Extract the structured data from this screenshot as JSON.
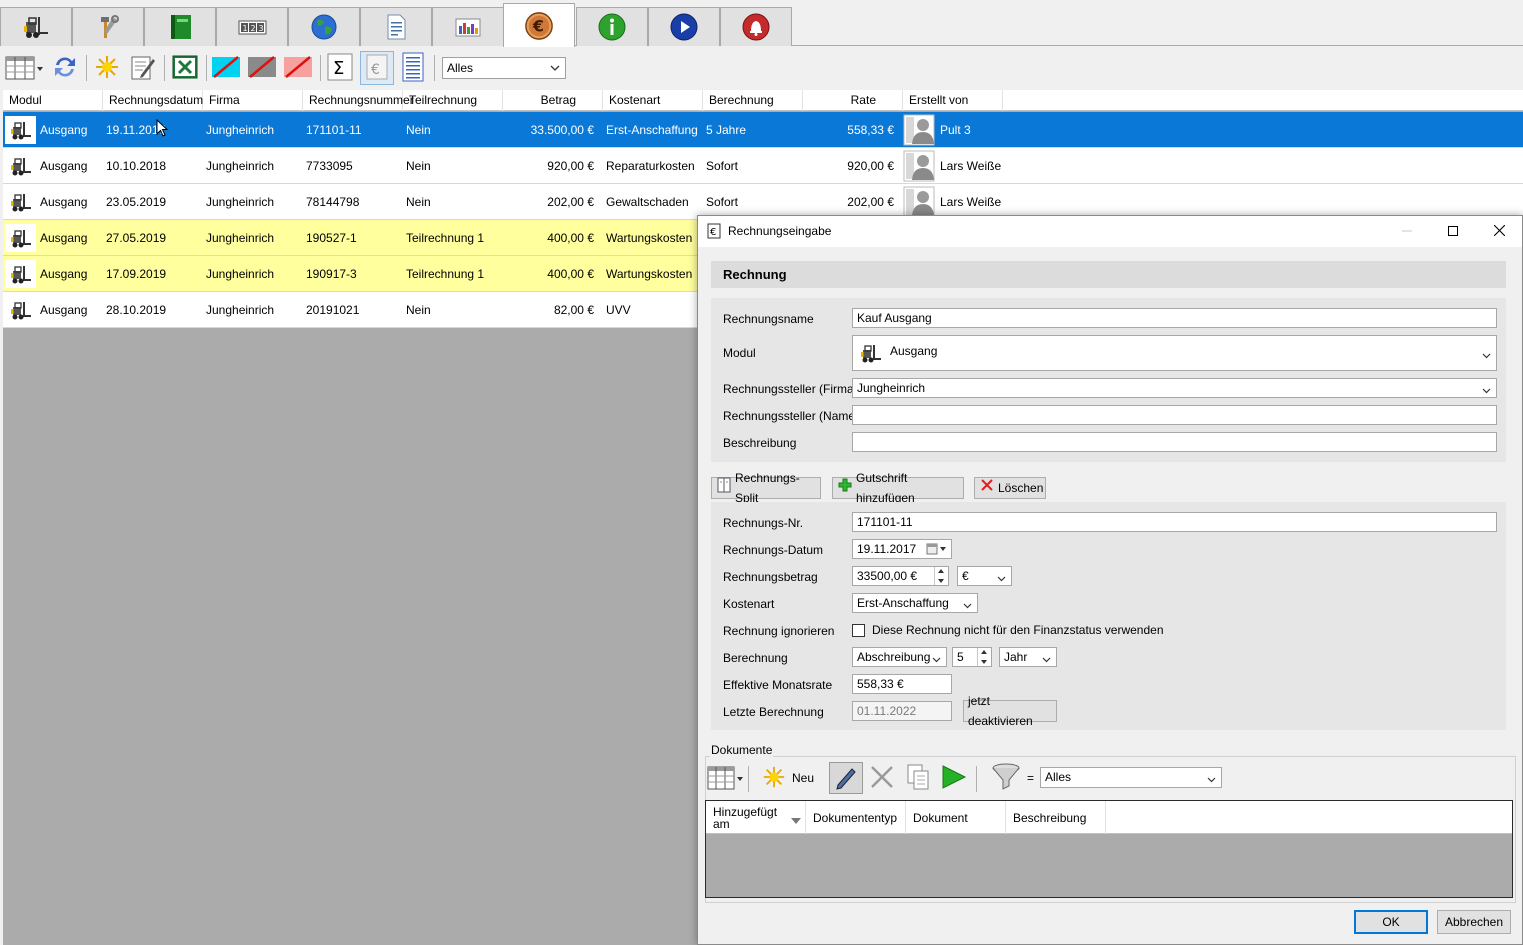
{
  "tabs": [
    {
      "name": "forklift-tab",
      "icon": "forklift-icon"
    },
    {
      "name": "tools-tab",
      "icon": "hammer-wrench-icon"
    },
    {
      "name": "book-tab",
      "icon": "green-book-icon"
    },
    {
      "name": "counter-tab",
      "icon": "counter-icon"
    },
    {
      "name": "globe-tab",
      "icon": "globe-icon"
    },
    {
      "name": "document-tab",
      "icon": "document-icon"
    },
    {
      "name": "chart-tab",
      "icon": "bar-chart-icon"
    },
    {
      "name": "invoice-tab",
      "icon": "euro-icon",
      "active": true
    },
    {
      "name": "info-tab",
      "icon": "info-icon"
    },
    {
      "name": "play-tab",
      "icon": "play-icon"
    },
    {
      "name": "alarm-tab",
      "icon": "alarm-bell-icon"
    }
  ],
  "toolbar": {
    "filter_value": "Alles"
  },
  "grid": {
    "columns": [
      "Modul",
      "Rechnungsdatum",
      "Firma",
      "Rechnungsnummer",
      "Teilrechnung",
      "Betrag",
      "Kostenart",
      "Berechnung",
      "Rate",
      "Erstellt von"
    ],
    "rows": [
      {
        "modul": "Ausgang",
        "datum": "19.11.2017",
        "firma": "Jungheinrich",
        "nummer": "171101-11",
        "teil": "Nein",
        "betrag": "33.500,00 €",
        "kostenart": "Erst-Anschaffung",
        "berechnung": "5 Jahre",
        "rate": "558,33 €",
        "erstellt": "Pult 3"
      },
      {
        "modul": "Ausgang",
        "datum": "10.10.2018",
        "firma": "Jungheinrich",
        "nummer": "7733095",
        "teil": "Nein",
        "betrag": "920,00 €",
        "kostenart": "Reparaturkosten",
        "berechnung": "Sofort",
        "rate": "920,00 €",
        "erstellt": "Lars Weiße"
      },
      {
        "modul": "Ausgang",
        "datum": "23.05.2019",
        "firma": "Jungheinrich",
        "nummer": "78144798",
        "teil": "Nein",
        "betrag": "202,00 €",
        "kostenart": "Gewaltschaden",
        "berechnung": "Sofort",
        "rate": "202,00 €",
        "erstellt": "Lars Weiße"
      },
      {
        "modul": "Ausgang",
        "datum": "27.05.2019",
        "firma": "Jungheinrich",
        "nummer": "190527-1",
        "teil": "Teilrechnung 1",
        "betrag": "400,00 €",
        "kostenart": "Wartungskosten",
        "berechnung": "",
        "rate": "",
        "erstellt": ""
      },
      {
        "modul": "Ausgang",
        "datum": "17.09.2019",
        "firma": "Jungheinrich",
        "nummer": "190917-3",
        "teil": "Teilrechnung 1",
        "betrag": "400,00 €",
        "kostenart": "Wartungskosten",
        "berechnung": "",
        "rate": "",
        "erstellt": ""
      },
      {
        "modul": "Ausgang",
        "datum": "28.10.2019",
        "firma": "Jungheinrich",
        "nummer": "20191021",
        "teil": "Nein",
        "betrag": "82,00 €",
        "kostenart": "UVV",
        "berechnung": "",
        "rate": "",
        "erstellt": ""
      }
    ]
  },
  "dialog": {
    "title": "Rechnungseingabe",
    "section_title": "Rechnung",
    "labels": {
      "name": "Rechnungsname",
      "modul": "Modul",
      "firma": "Rechnungssteller (Firma)",
      "steller_name": "Rechnungssteller (Name)",
      "beschreibung": "Beschreibung",
      "nr": "Rechnungs-Nr.",
      "datum": "Rechnungs-Datum",
      "betrag": "Rechnungsbetrag",
      "kostenart": "Kostenart",
      "ignorieren": "Rechnung ignorieren",
      "berechnung": "Berechnung",
      "monatsrate": "Effektive Monatsrate",
      "letzte": "Letzte Berechnung"
    },
    "values": {
      "name": "Kauf Ausgang",
      "modul": "Ausgang",
      "firma": "Jungheinrich",
      "steller_name": "",
      "beschreibung": "",
      "nr": "171101-11",
      "datum": "19.11.2017",
      "betrag": "33500,00 €",
      "waehrung": "€",
      "kostenart": "Erst-Anschaffung",
      "ignorieren_text": "Diese Rechnung nicht für den Finanzstatus verwenden",
      "berechnung_art": "Abschreibung",
      "berechnung_anzahl": "5",
      "berechnung_einheit": "Jahr",
      "monatsrate": "558,33  €",
      "letzte": "01.11.2022"
    },
    "buttons": {
      "split": "Rechnungs-Split",
      "gutschrift": "Gutschrift hinzufügen",
      "loeschen": "Löschen",
      "deaktivieren": "jetzt deaktivieren",
      "ok": "OK",
      "abbrechen": "Abbrechen"
    },
    "documents": {
      "label": "Dokumente",
      "neu": "Neu",
      "filter_eq": "=",
      "filter_value": "Alles",
      "columns": [
        "Hinzugefügt am",
        "Dokumententyp",
        "Dokument",
        "Beschreibung"
      ]
    }
  }
}
